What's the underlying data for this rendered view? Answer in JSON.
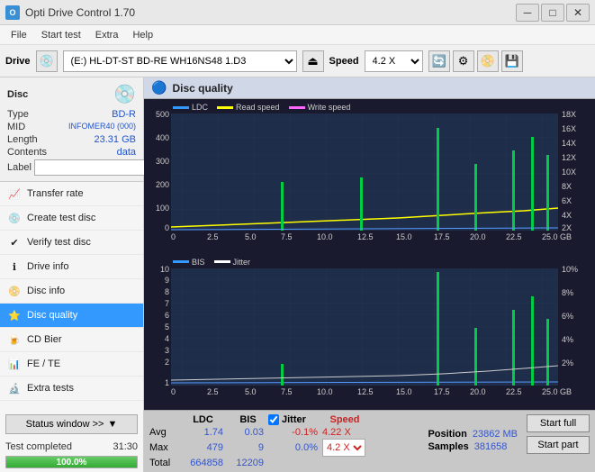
{
  "app": {
    "title": "Opti Drive Control 1.70",
    "icon": "O"
  },
  "titlebar": {
    "minimize": "─",
    "maximize": "□",
    "close": "✕"
  },
  "menu": {
    "items": [
      "File",
      "Start test",
      "Extra",
      "Help"
    ]
  },
  "drive_bar": {
    "drive_label": "Drive",
    "drive_value": "(E:)  HL-DT-ST BD-RE  WH16NS48 1.D3",
    "speed_label": "Speed",
    "speed_value": "4.2 X"
  },
  "disc": {
    "type_label": "Type",
    "type_val": "BD-R",
    "mid_label": "MID",
    "mid_val": "INFOMER40 (000)",
    "length_label": "Length",
    "length_val": "23.31 GB",
    "contents_label": "Contents",
    "contents_val": "data",
    "label_label": "Label",
    "label_val": ""
  },
  "nav": {
    "items": [
      {
        "id": "transfer-rate",
        "label": "Transfer rate",
        "icon": "📈"
      },
      {
        "id": "create-test",
        "label": "Create test disc",
        "icon": "💿"
      },
      {
        "id": "verify-test",
        "label": "Verify test disc",
        "icon": "✔"
      },
      {
        "id": "drive-info",
        "label": "Drive info",
        "icon": "ℹ"
      },
      {
        "id": "disc-info",
        "label": "Disc info",
        "icon": "📀"
      },
      {
        "id": "disc-quality",
        "label": "Disc quality",
        "icon": "⭐",
        "active": true
      },
      {
        "id": "cd-bier",
        "label": "CD Bier",
        "icon": "🍺"
      },
      {
        "id": "fe-te",
        "label": "FE / TE",
        "icon": "📊"
      },
      {
        "id": "extra-tests",
        "label": "Extra tests",
        "icon": "🔬"
      }
    ]
  },
  "status": {
    "btn_label": "Status window >>",
    "text": "Test completed",
    "time": "31:30",
    "progress": 100,
    "progress_text": "100.0%"
  },
  "quality": {
    "title": "Disc quality",
    "legend1": [
      {
        "label": "LDC",
        "color": "#3399ff"
      },
      {
        "label": "Read speed",
        "color": "#ffff00"
      },
      {
        "label": "Write speed",
        "color": "#ff66ff"
      }
    ],
    "legend2": [
      {
        "label": "BIS",
        "color": "#3399ff"
      },
      {
        "label": "Jitter",
        "color": "#ffffff"
      }
    ],
    "chart1": {
      "y_left": [
        "500",
        "400",
        "300",
        "200",
        "100",
        "0"
      ],
      "y_right": [
        "18X",
        "16X",
        "14X",
        "12X",
        "10X",
        "8X",
        "6X",
        "4X",
        "2X"
      ],
      "x": [
        "0",
        "2.5",
        "5.0",
        "7.5",
        "10.0",
        "12.5",
        "15.0",
        "17.5",
        "20.0",
        "22.5",
        "25.0 GB"
      ]
    },
    "chart2": {
      "y_left": [
        "10",
        "9",
        "8",
        "7",
        "6",
        "5",
        "4",
        "3",
        "2",
        "1"
      ],
      "y_right": [
        "10%",
        "8%",
        "6%",
        "4%",
        "2%"
      ],
      "x": [
        "0",
        "2.5",
        "5.0",
        "7.5",
        "10.0",
        "12.5",
        "15.0",
        "17.5",
        "20.0",
        "22.5",
        "25.0 GB"
      ]
    }
  },
  "stats": {
    "col_ldc": "LDC",
    "col_bis": "BIS",
    "col_jitter": "Jitter",
    "col_speed": "Speed",
    "col_position": "Position",
    "col_samples": "Samples",
    "rows": [
      {
        "label": "Avg",
        "ldc": "1.74",
        "bis": "0.03",
        "jitter": "-0.1%",
        "speed_val": "4.22 X",
        "speed_select": "4.2 X",
        "position_label": "Position",
        "position_val": "23862 MB"
      },
      {
        "label": "Max",
        "ldc": "479",
        "bis": "9",
        "jitter": "0.0%",
        "samples_label": "Samples",
        "samples_val": "381658"
      },
      {
        "label": "Total",
        "ldc": "664858",
        "bis": "12209",
        "jitter": ""
      }
    ],
    "jitter_checked": true,
    "btn_start_full": "Start full",
    "btn_start_part": "Start part"
  }
}
